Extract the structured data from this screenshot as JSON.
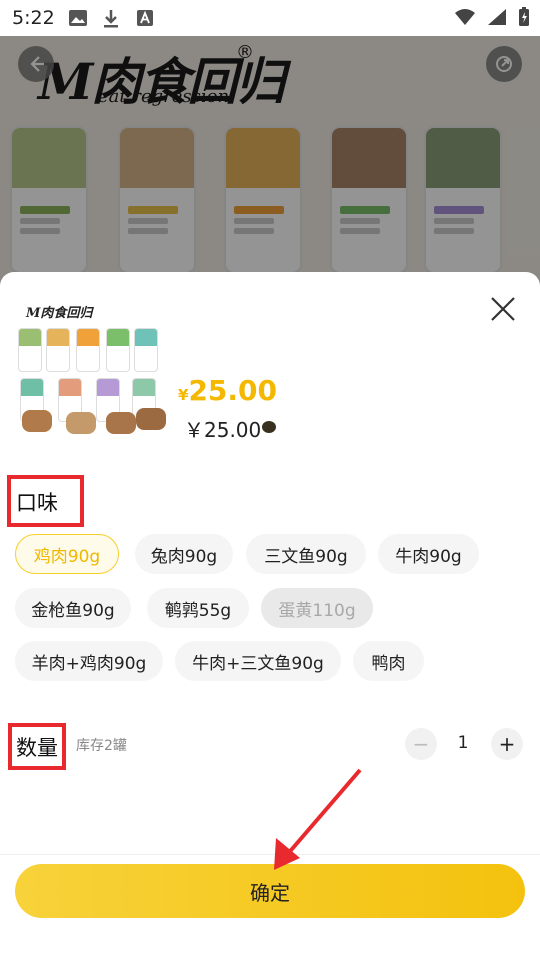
{
  "status_bar": {
    "time": "5:22"
  },
  "background_page": {
    "brand_logo": "M肉食回归",
    "brand_logo_sub": "eat regression",
    "brand_reg_mark": "®"
  },
  "sheet": {
    "thumbnail_logo": "M肉食回归",
    "price_main_currency": "¥",
    "price_main_value": "25.00",
    "price_sub": "￥25.00",
    "flavor_title": "口味",
    "flavor_options": [
      {
        "label": "鸡肉90g",
        "state": "selected"
      },
      {
        "label": "兔肉90g",
        "state": "normal"
      },
      {
        "label": "三文鱼90g",
        "state": "normal"
      },
      {
        "label": "牛肉90g",
        "state": "normal"
      },
      {
        "label": "金枪鱼90g",
        "state": "normal"
      },
      {
        "label": "鹌鹑55g",
        "state": "normal"
      },
      {
        "label": "蛋黄110g",
        "state": "disabled"
      },
      {
        "label": "羊肉+鸡肉90g",
        "state": "normal"
      },
      {
        "label": "牛肉+三文鱼90g",
        "state": "normal"
      },
      {
        "label": "鸭肉",
        "state": "normal"
      }
    ],
    "quantity_title": "数量",
    "stock_label": "库存2罐",
    "quantity_minus": "−",
    "quantity_value": "1",
    "quantity_plus": "+",
    "confirm_label": "确定"
  },
  "colors": {
    "accent": "#f5b800",
    "highlight": "#e8292d",
    "button_gradient_start": "#f7d23a",
    "button_gradient_end": "#f4c20e"
  }
}
